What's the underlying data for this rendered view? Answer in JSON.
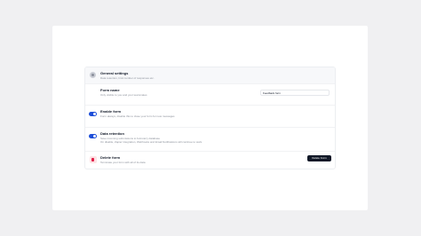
{
  "settings": {
    "header": {
      "title": "General settings",
      "description": "Data retention, limit number of responses etc."
    },
    "form_name": {
      "title": "Form name",
      "description": "Only visible to you and your teammates",
      "value": "Feedback form"
    },
    "enable_form": {
      "title": "Enable form",
      "description": "Form always, disable this to close your form for new messages",
      "enabled": true
    },
    "data_retention": {
      "title": "Data retention",
      "description_line1": "Save incoming submissions to formcarry database",
      "description_line2": "On disable, Zapier integration, Webhooks and Email Notifications will continue to work.",
      "enabled": true
    },
    "delete_form": {
      "title": "Delete form",
      "description": "Terminate your form with all of its data",
      "button_label": "Delete Form"
    }
  },
  "colors": {
    "accent": "#1d4ed8",
    "danger": "#e11d48",
    "button_dark": "#111827"
  }
}
